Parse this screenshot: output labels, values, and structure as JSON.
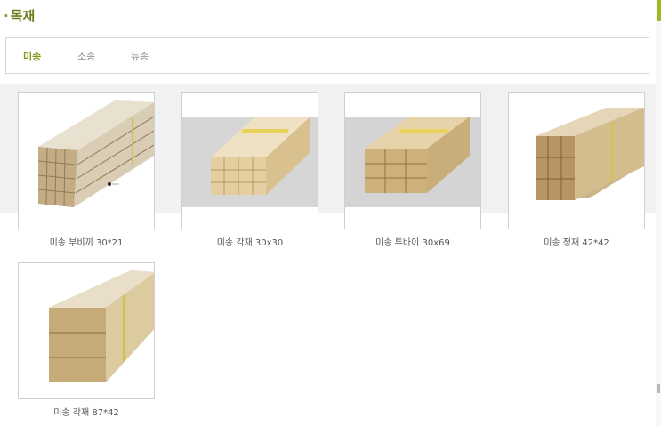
{
  "section": {
    "title": "목재",
    "bullet": "·"
  },
  "tabs": [
    {
      "label": "미송",
      "active": true
    },
    {
      "label": "소송",
      "active": false
    },
    {
      "label": "뉴송",
      "active": false
    }
  ],
  "products": [
    {
      "name": "미송 부비끼 30*21",
      "image": "stacked-boards-icon"
    },
    {
      "name": "미송 각재 30x30",
      "image": "square-lumber-bundle-icon"
    },
    {
      "name": "미송 투바이 30x69",
      "image": "two-by-lumber-bundle-icon"
    },
    {
      "name": "미송 정재 42*42",
      "image": "square-timber-bundle-icon"
    },
    {
      "name": "미송 각재 87*42",
      "image": "large-beam-bundle-icon"
    }
  ],
  "colors": {
    "accent": "#7a9a16",
    "title": "#6f7d1f",
    "band": "#f1f1f1"
  }
}
